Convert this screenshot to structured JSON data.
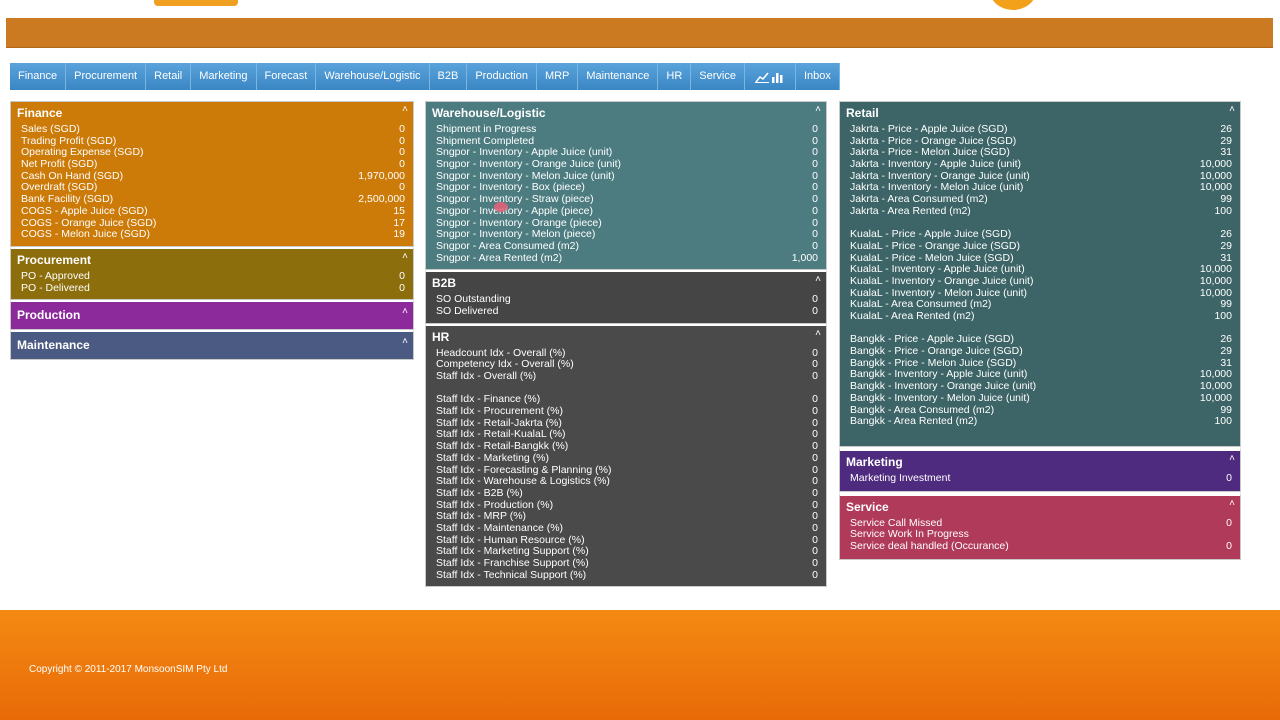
{
  "nav": {
    "items": [
      "Finance",
      "Procurement",
      "Retail",
      "Marketing",
      "Forecast",
      "Warehouse/Logistic",
      "B2B",
      "Production",
      "MRP",
      "Maintenance",
      "HR",
      "Service",
      "Inbox"
    ],
    "chart_icon": "chart-icon"
  },
  "caret": "˄",
  "finance": {
    "title": "Finance",
    "rows": [
      {
        "label": "Sales (SGD)",
        "value": "0"
      },
      {
        "label": "Trading Profit (SGD)",
        "value": "0"
      },
      {
        "label": "Operating Expense (SGD)",
        "value": "0"
      },
      {
        "label": "Net Profit (SGD)",
        "value": "0"
      },
      {
        "label": "Cash On Hand (SGD)",
        "value": "1,970,000"
      },
      {
        "label": "Overdraft (SGD)",
        "value": "0"
      },
      {
        "label": "Bank Facility (SGD)",
        "value": "2,500,000"
      },
      {
        "label": "COGS - Apple Juice (SGD)",
        "value": "15"
      },
      {
        "label": "COGS - Orange Juice (SGD)",
        "value": "17"
      },
      {
        "label": "COGS - Melon Juice (SGD)",
        "value": "19"
      }
    ]
  },
  "procurement": {
    "title": "Procurement",
    "rows": [
      {
        "label": "PO - Approved",
        "value": "0"
      },
      {
        "label": "PO - Delivered",
        "value": "0"
      }
    ]
  },
  "production": {
    "title": "Production"
  },
  "maintenance": {
    "title": "Maintenance"
  },
  "warehouse": {
    "title": "Warehouse/Logistic",
    "rows": [
      {
        "label": "Shipment in Progress",
        "value": "0"
      },
      {
        "label": "Shipment Completed",
        "value": "0"
      },
      {
        "label": "Sngpor - Inventory - Apple Juice (unit)",
        "value": "0"
      },
      {
        "label": "Sngpor - Inventory - Orange Juice (unit)",
        "value": "0"
      },
      {
        "label": "Sngpor - Inventory - Melon Juice (unit)",
        "value": "0"
      },
      {
        "label": "Sngpor - Inventory - Box (piece)",
        "value": "0"
      },
      {
        "label": "Sngpor - Inventory - Straw (piece)",
        "value": "0"
      },
      {
        "label": "Sngpor - Inventory - Apple (piece)",
        "value": "0"
      },
      {
        "label": "Sngpor - Inventory - Orange (piece)",
        "value": "0"
      },
      {
        "label": "Sngpor - Inventory - Melon (piece)",
        "value": "0"
      },
      {
        "label": "Sngpor - Area Consumed (m2)",
        "value": "0"
      },
      {
        "label": "Sngpor - Area Rented (m2)",
        "value": "1,000"
      }
    ]
  },
  "b2b": {
    "title": "B2B",
    "rows": [
      {
        "label": "SO Outstanding",
        "value": "0"
      },
      {
        "label": "SO Delivered",
        "value": "0"
      }
    ]
  },
  "hr": {
    "title": "HR",
    "rows_top": [
      {
        "label": "Headcount Idx - Overall (%)",
        "value": "0"
      },
      {
        "label": "Competency Idx - Overall (%)",
        "value": "0"
      },
      {
        "label": "Staff Idx - Overall (%)",
        "value": "0"
      }
    ],
    "rows_bottom": [
      {
        "label": "Staff Idx - Finance (%)",
        "value": "0"
      },
      {
        "label": "Staff Idx - Procurement (%)",
        "value": "0"
      },
      {
        "label": "Staff Idx - Retail-Jakrta (%)",
        "value": "0"
      },
      {
        "label": "Staff Idx - Retail-KualaL (%)",
        "value": "0"
      },
      {
        "label": "Staff Idx - Retail-Bangkk (%)",
        "value": "0"
      },
      {
        "label": "Staff Idx - Marketing (%)",
        "value": "0"
      },
      {
        "label": "Staff Idx - Forecasting & Planning (%)",
        "value": "0"
      },
      {
        "label": "Staff Idx - Warehouse & Logistics (%)",
        "value": "0"
      },
      {
        "label": "Staff Idx - B2B (%)",
        "value": "0"
      },
      {
        "label": "Staff Idx - Production (%)",
        "value": "0"
      },
      {
        "label": "Staff Idx - MRP (%)",
        "value": "0"
      },
      {
        "label": "Staff Idx - Maintenance (%)",
        "value": "0"
      },
      {
        "label": "Staff Idx - Human Resource (%)",
        "value": "0"
      },
      {
        "label": "Staff Idx - Marketing Support (%)",
        "value": "0"
      },
      {
        "label": "Staff Idx - Franchise Support (%)",
        "value": "0"
      },
      {
        "label": "Staff Idx - Technical Support (%)",
        "value": "0"
      }
    ]
  },
  "retail": {
    "title": "Retail",
    "groups": [
      [
        {
          "label": "Jakrta - Price - Apple Juice (SGD)",
          "value": "26"
        },
        {
          "label": "Jakrta - Price - Orange Juice (SGD)",
          "value": "29"
        },
        {
          "label": "Jakrta - Price - Melon Juice (SGD)",
          "value": "31"
        },
        {
          "label": "Jakrta - Inventory - Apple Juice (unit)",
          "value": "10,000"
        },
        {
          "label": "Jakrta - Inventory - Orange Juice (unit)",
          "value": "10,000"
        },
        {
          "label": "Jakrta - Inventory - Melon Juice (unit)",
          "value": "10,000"
        },
        {
          "label": "Jakrta - Area Consumed (m2)",
          "value": "99"
        },
        {
          "label": "Jakrta - Area Rented (m2)",
          "value": "100"
        }
      ],
      [
        {
          "label": "KualaL - Price - Apple Juice (SGD)",
          "value": "26"
        },
        {
          "label": "KualaL - Price - Orange Juice (SGD)",
          "value": "29"
        },
        {
          "label": "KualaL - Price - Melon Juice (SGD)",
          "value": "31"
        },
        {
          "label": "KualaL - Inventory - Apple Juice (unit)",
          "value": "10,000"
        },
        {
          "label": "KualaL - Inventory - Orange Juice (unit)",
          "value": "10,000"
        },
        {
          "label": "KualaL - Inventory - Melon Juice (unit)",
          "value": "10,000"
        },
        {
          "label": "KualaL - Area Consumed (m2)",
          "value": "99"
        },
        {
          "label": "KualaL - Area Rented (m2)",
          "value": "100"
        }
      ],
      [
        {
          "label": "Bangkk - Price - Apple Juice (SGD)",
          "value": "26"
        },
        {
          "label": "Bangkk - Price - Orange Juice (SGD)",
          "value": "29"
        },
        {
          "label": "Bangkk - Price - Melon Juice (SGD)",
          "value": "31"
        },
        {
          "label": "Bangkk - Inventory - Apple Juice (unit)",
          "value": "10,000"
        },
        {
          "label": "Bangkk - Inventory - Orange Juice (unit)",
          "value": "10,000"
        },
        {
          "label": "Bangkk - Inventory - Melon Juice (unit)",
          "value": "10,000"
        },
        {
          "label": "Bangkk - Area Consumed (m2)",
          "value": "99"
        },
        {
          "label": "Bangkk - Area Rented (m2)",
          "value": "100"
        }
      ]
    ]
  },
  "marketing": {
    "title": "Marketing",
    "rows": [
      {
        "label": "Marketing Investment",
        "value": "0"
      }
    ]
  },
  "service": {
    "title": "Service",
    "rows": [
      {
        "label": "Service Call Missed",
        "value": "0"
      },
      {
        "label": "Service Work In Progress",
        "value": ""
      },
      {
        "label": "Service deal handled (Occurance)",
        "value": "0"
      }
    ]
  },
  "footer": {
    "copyright": "Copyright © 2011-2017 MonsoonSIM Pty Ltd"
  }
}
